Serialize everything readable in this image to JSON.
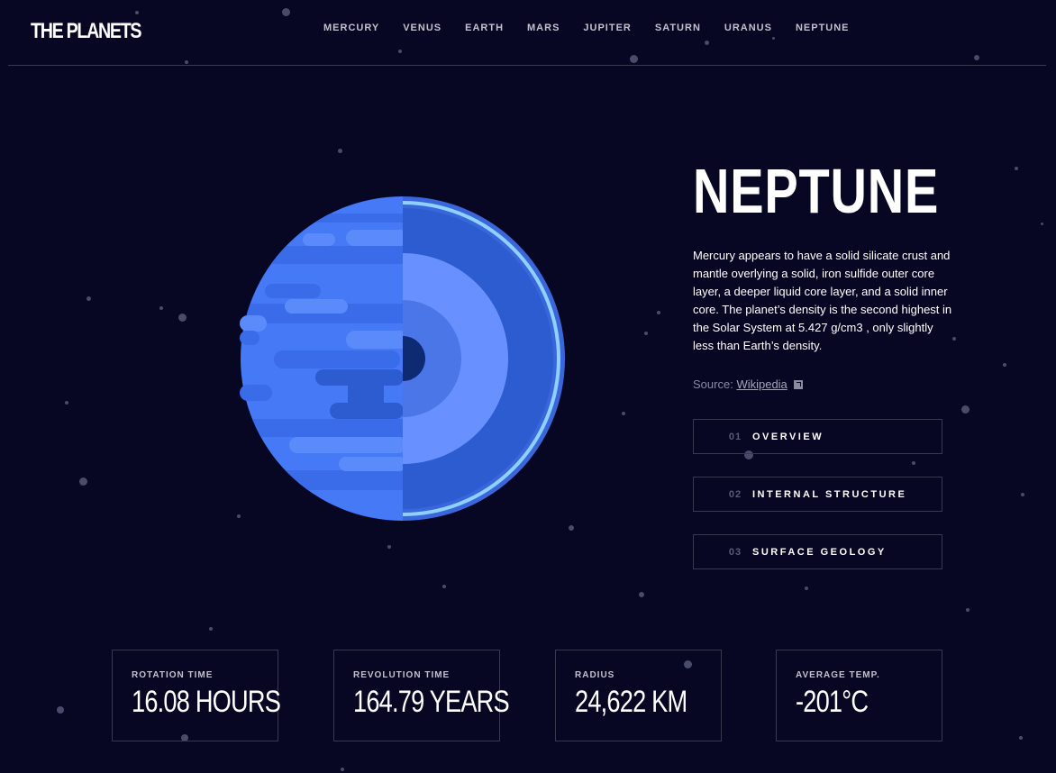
{
  "header": {
    "logo": "THE PLANETS",
    "nav": [
      "MERCURY",
      "VENUS",
      "EARTH",
      "MARS",
      "JUPITER",
      "SATURN",
      "URANUS",
      "NEPTUNE"
    ]
  },
  "planet": {
    "name": "NEPTUNE",
    "description": "Mercury appears to have a solid silicate crust and mantle overlying a solid, iron sulfide outer core layer, a deeper liquid core layer, and a solid inner core. The planet’s density is the second highest in the Solar System at 5.427 g/cm3 , only slightly less than Earth’s density.",
    "source_label": "Source:",
    "source_link": "Wikipedia",
    "accent_colors": [
      "#4579f5",
      "#2d5bd0",
      "#6891ff",
      "#8fd0ff",
      "#0e2a72"
    ]
  },
  "tabs": [
    {
      "num": "01",
      "label": "OVERVIEW"
    },
    {
      "num": "02",
      "label": "INTERNAL STRUCTURE"
    },
    {
      "num": "03",
      "label": "SURFACE GEOLOGY"
    }
  ],
  "stats": [
    {
      "label": "ROTATION TIME",
      "value": "16.08 HOURS"
    },
    {
      "label": "REVOLUTION TIME",
      "value": "164.79 YEARS"
    },
    {
      "label": "RADIUS",
      "value": "24,622 KM"
    },
    {
      "label": "AVERAGE TEMP.",
      "value": "-201°C"
    }
  ]
}
